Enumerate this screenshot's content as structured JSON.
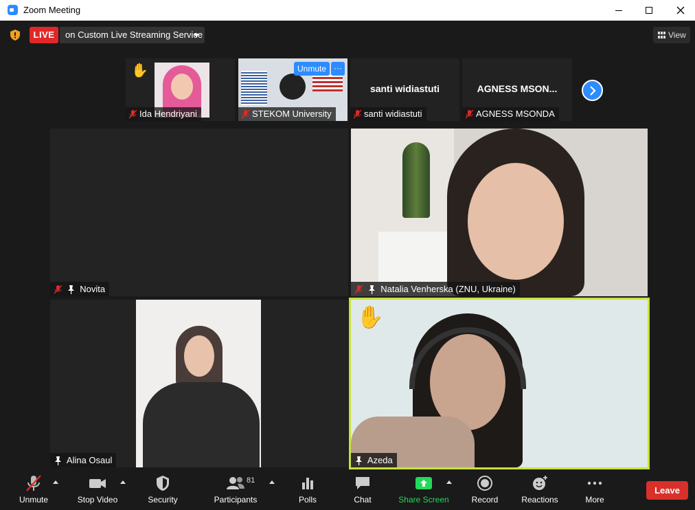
{
  "window": {
    "title": "Zoom Meeting"
  },
  "topbar": {
    "live_label": "LIVE",
    "live_service": "on Custom Live Streaming Service",
    "view_label": "View"
  },
  "strip": [
    {
      "name": "Ida Hendriyani",
      "hand_raised": true
    },
    {
      "name": "STEKOM University",
      "overlay_button": "Unmute",
      "more_button": "···"
    },
    {
      "name": "santi widiastuti",
      "display": "santi widiastuti"
    },
    {
      "name": "AGNESS MSONDA",
      "display": "AGNESS  MSON..."
    }
  ],
  "tiles": [
    {
      "name": "Novita",
      "muted": true,
      "pinned": true
    },
    {
      "name": "Natalia Venherska (ZNU, Ukraine)",
      "muted": true,
      "pinned": true
    },
    {
      "name": "Alina Osaul",
      "pinned": true
    },
    {
      "name": "Azeda",
      "pinned": true,
      "active_speaker": true,
      "hand_raised": true
    }
  ],
  "toolbar": {
    "unmute": "Unmute",
    "stop_video": "Stop Video",
    "security": "Security",
    "participants": "Participants",
    "participants_count": "81",
    "polls": "Polls",
    "chat": "Chat",
    "share_screen": "Share Screen",
    "record": "Record",
    "reactions": "Reactions",
    "more": "More",
    "leave": "Leave"
  },
  "colors": {
    "live_red": "#e02828",
    "share_green": "#23d959",
    "accent_blue": "#2d8cff",
    "active_border": "#c7e23d",
    "leave_red": "#d9302a"
  }
}
